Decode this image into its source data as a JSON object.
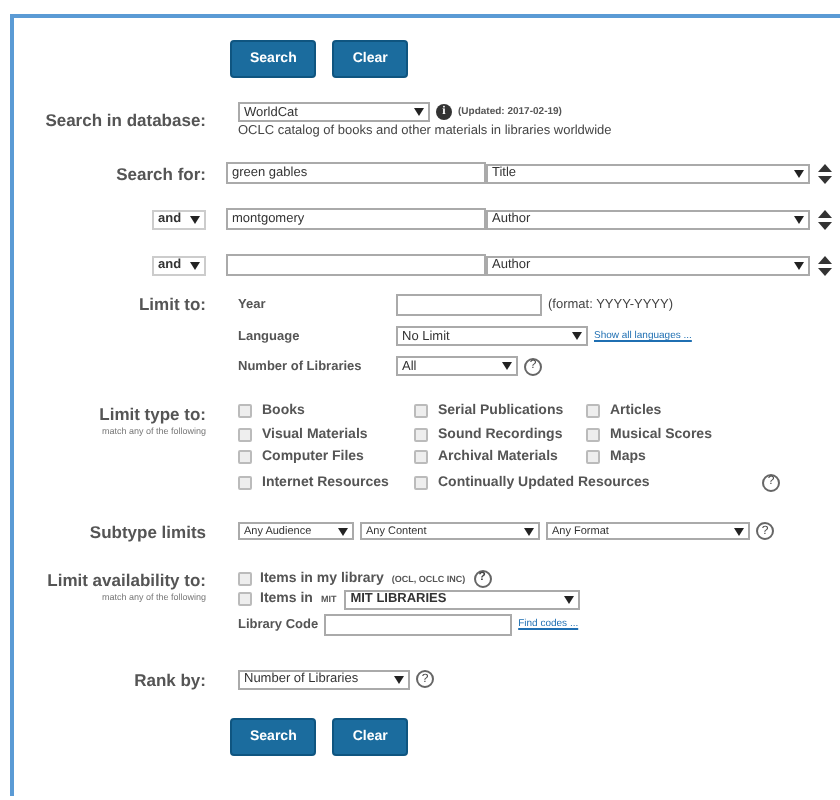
{
  "buttons_top": [
    "Search",
    "Clear"
  ],
  "database": {
    "label": "Search in database:",
    "value": "WorldCat",
    "info": "i",
    "updated": "(Updated: 2017-02-19)",
    "description": "OCLC catalog of books and other materials in libraries worldwide"
  },
  "search": {
    "label": "Search for:",
    "rows": [
      {
        "term": "green gables",
        "field": "Title"
      },
      {
        "operator": "and",
        "term": "montgomery",
        "field": "Author"
      },
      {
        "operator": "and",
        "field": "Author"
      }
    ]
  },
  "limit": {
    "label": "Limit to:",
    "fields": [
      {
        "kind": "input",
        "label": "Year",
        "hint": "(format: YYYY-YYYY)"
      },
      {
        "kind": "select",
        "label": "Language",
        "value": "No Limit",
        "link": "Show all languages ..."
      },
      {
        "kind": "select",
        "label": "Number of Libraries",
        "value": "All",
        "help": "?"
      }
    ]
  },
  "limit_type": {
    "label": "Limit type to:",
    "hint": "match any of the following",
    "help": "?",
    "options": [
      {
        "label": "Books",
        "checked": false
      },
      {
        "label": "Serial Publications",
        "checked": false
      },
      {
        "label": "Articles",
        "checked": false
      },
      {
        "label": "Visual Materials",
        "checked": false
      },
      {
        "label": "Sound Recordings",
        "checked": false
      },
      {
        "label": "Musical Scores",
        "checked": false
      },
      {
        "label": "Computer Files",
        "checked": false
      },
      {
        "label": "Archival Materials",
        "checked": false
      },
      {
        "label": "Maps",
        "checked": false
      },
      {
        "label": "Internet Resources",
        "checked": false
      },
      {
        "label": "Continually Updated Resources",
        "checked": false
      }
    ]
  },
  "subtype": {
    "label": "Subtype limits",
    "selects": [
      "Any Audience",
      "Any Content",
      "Any Format"
    ],
    "help": "?"
  },
  "availability": {
    "label": "Limit availability to:",
    "hint": "match any of the following",
    "options": [
      {
        "label": "Items in my library",
        "note": "(OCL, OCLC INC)",
        "checked": false,
        "help": "?"
      },
      {
        "label": "Items in",
        "note": "MIT",
        "checked": false,
        "select": "MIT LIBRARIES"
      }
    ],
    "code_label": "Library Code",
    "code_link": "Find codes ..."
  },
  "rank": {
    "label": "Rank by:",
    "value": "Number of Libraries",
    "help": "?"
  },
  "buttons_bottom": [
    "Search",
    "Clear"
  ]
}
